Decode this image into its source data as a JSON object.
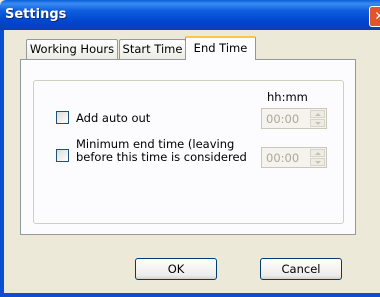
{
  "window": {
    "title": "Settings",
    "close_glyph": "✕"
  },
  "tabs": [
    {
      "label": "Working Hours"
    },
    {
      "label": "Start Time"
    },
    {
      "label": "End Time"
    }
  ],
  "active_tab": "End Time",
  "group": {
    "column_header": "hh:mm",
    "options": [
      {
        "label": "Add auto out",
        "checked": false,
        "time_value": "00:00"
      },
      {
        "label_line1": "Minimum end time (leaving",
        "label_line2": "before this time is considered",
        "checked": false,
        "time_value": "00:00"
      }
    ]
  },
  "buttons": {
    "ok": "OK",
    "cancel": "Cancel"
  },
  "icons": {
    "checkbox": "checkbox-icon",
    "spin_up": "spin-up-icon",
    "spin_down": "spin-down-icon",
    "close": "close-icon"
  },
  "colors": {
    "title_bar": "#0054e3",
    "active_tab_accent": "#ffc83c",
    "face": "#ece9d8"
  }
}
